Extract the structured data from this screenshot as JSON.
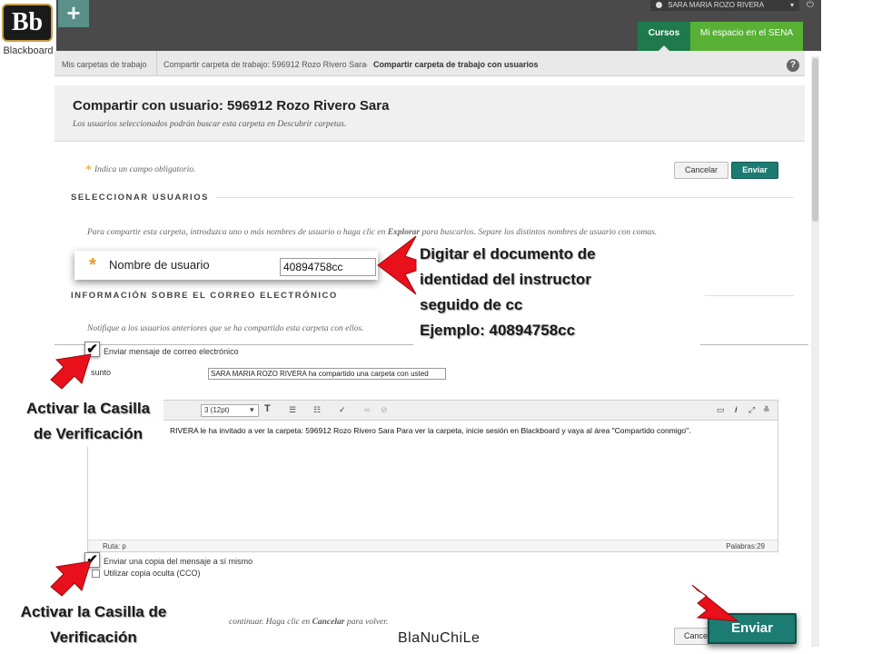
{
  "brand": {
    "logo_mark": "Bb",
    "logo_word": "Blackboard",
    "plus_icon": "plus-icon"
  },
  "header": {
    "user_name": "SARA MARIA ROZO RIVERA",
    "tab_courses": "Cursos",
    "tab_space": "Mi espacio en el SENA"
  },
  "breadcrumb": [
    "Mis carpetas de trabajo",
    "Compartir carpeta de trabajo: 596912 Rozo Rivero Sara",
    "Compartir carpeta de trabajo con usuarios"
  ],
  "help_label": "?",
  "page": {
    "title": "Compartir con usuario: 596912 Rozo Rivero Sara",
    "subtitle": "Los usuarios seleccionados podrán buscar esta carpeta en Descubrir carpetas."
  },
  "form": {
    "required_note": "Indica un campo obligatorio.",
    "cancel_label": "Cancelar",
    "submit_label": "Enviar",
    "section_users": "SELECCIONAR USUARIOS",
    "users_instruction_pre": "Para compartir esta carpeta, introduzca uno o más nombres de usuario o haga clic en ",
    "users_instruction_link": "Explorar",
    "users_instruction_post": " para buscarlos. Separe los distintos nombres de usuario con comas.",
    "username_label": "Nombre de usuario",
    "username_value": "40894758cc",
    "section_email": "INFORMACIÓN SOBRE EL CORREO ELECTRÓNICO",
    "email_instruction": "Notifique a los usuarios anteriores que se ha compartido esta carpeta con ellos.",
    "send_email_label": "Enviar mensaje de correo electrónico",
    "subject_label": "sunto",
    "subject_value": "SARA MARIA ROZO RIVERA ha compartido una carpeta con usted",
    "font_size_value": "3 (12pt)",
    "message_body": "RIVERA le ha invitado a ver la carpeta: 596912 Rozo Rivero Sara Para ver la carpeta, inicie sesión en Blackboard y vaya al área \"Compartido conmigo\".",
    "status_path": "Ruta: p",
    "status_words": "Palabras:29",
    "copy_self_label": "Enviar una copia del mensaje a sí mismo",
    "bcc_label": "Utilizar copia oculta (CCO)",
    "footer_instruction_pre": "continuar. Haga clic en ",
    "footer_instruction_link": "Cancelar",
    "footer_instruction_post": " para volver.",
    "bottom_cancel_label": "Cancelar",
    "bottom_submit_label": "Enviar"
  },
  "annotations": {
    "callout_lines": [
      "Digitar el documento de",
      "identidad del instructor",
      "seguido de  cc",
      "Ejemplo: 40894758cc"
    ],
    "checkbox_note_1": [
      "Activar la Casilla",
      "de Verificación"
    ],
    "checkbox_note_2": [
      "Activar la Casilla de",
      "Verificación"
    ],
    "credit": "BlaNuChiLe"
  },
  "colors": {
    "accent": "#1c7b72",
    "courses_tab": "#1e7a4a",
    "space_tab": "#58b134",
    "arrow": "#e8101a",
    "required": "#e89a2a"
  }
}
